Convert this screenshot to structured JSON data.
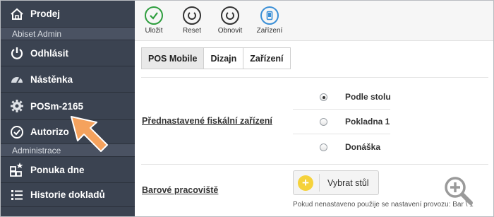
{
  "sidebar": {
    "items": [
      {
        "label": "Prodej",
        "icon": "home-icon"
      },
      {
        "label": "Odhlásit",
        "icon": "power-icon"
      },
      {
        "label": "Nástěnka",
        "icon": "dashboard-icon"
      },
      {
        "label": "POSm-2165",
        "icon": "gear-icon"
      },
      {
        "label": "Autorizo",
        "icon": "check-circle-icon"
      },
      {
        "label": "Ponuka dne",
        "icon": "blocks-star-icon"
      },
      {
        "label": "Historie dokladů",
        "icon": "list-icon"
      }
    ],
    "sections": [
      "Abiset Admin",
      "Administrace"
    ]
  },
  "toolbar": {
    "buttons": [
      {
        "label": "Uložit",
        "icon": "check-icon",
        "color": "#2e9e3e"
      },
      {
        "label": "Reset",
        "icon": "refresh-icon",
        "color": "#333333"
      },
      {
        "label": "Obnovit",
        "icon": "refresh-icon",
        "color": "#333333"
      },
      {
        "label": "Zařízení",
        "icon": "device-icon",
        "color": "#3a8fd6"
      }
    ]
  },
  "tabs": [
    {
      "label": "POS Mobile",
      "active": true
    },
    {
      "label": "Dizajn",
      "active": false
    },
    {
      "label": "Zařízení",
      "active": false
    }
  ],
  "form": {
    "fiscal_label": "Přednastavené fiskální zařízení",
    "fiscal_options": [
      {
        "label": "Podle stolu",
        "checked": true
      },
      {
        "label": "Pokladna 1",
        "checked": false
      },
      {
        "label": "Donáška",
        "checked": false
      }
    ],
    "bar_label": "Barové pracoviště",
    "select_button": "Vybrat stůl",
    "hint": "Pokud nenastaveno použije se nastavení provozu: Bar \\ 1"
  },
  "colors": {
    "sidebar_bg": "#3b4351",
    "section_bg": "#4a5262",
    "accent_arrow": "#f5a25d",
    "plus_yellow": "#f5d23b"
  }
}
